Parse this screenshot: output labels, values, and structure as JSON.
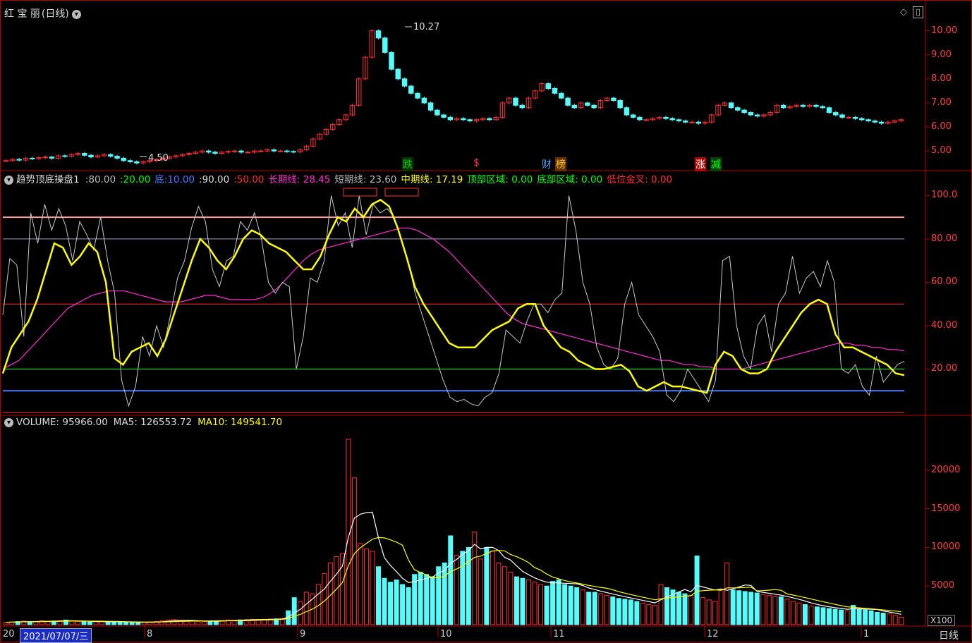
{
  "main_panel": {
    "stock_name": "红 宝 丽",
    "period": "(日线)",
    "high_label": "10.27",
    "low_label": "4.50",
    "yticks": [
      "10.00",
      "9.00",
      "8.00",
      "7.00",
      "6.00",
      "5.00"
    ],
    "signals": [
      {
        "text": "跌",
        "color": "#00cc00",
        "bg": "#003300"
      },
      {
        "text": "$",
        "color": "#ff3030",
        "bg": "#000"
      },
      {
        "text": "财",
        "color": "#4aa3ff",
        "bg": "#000"
      },
      {
        "text": "榜",
        "color": "#ffcc00",
        "bg": "#663300"
      },
      {
        "text": "涨",
        "color": "#ffffff",
        "bg": "#b00000"
      },
      {
        "text": "减",
        "color": "#00ff00",
        "bg": "#004400"
      }
    ]
  },
  "indicator_panel": {
    "name": "趋势顶底操盘1",
    "params": [
      {
        "label": ":80.00",
        "color": "#bbbbbb"
      },
      {
        "label": ":20.00",
        "color": "#00ff00"
      },
      {
        "label": "底:10.00",
        "color": "#4a7bff"
      },
      {
        "label": ":90.00",
        "color": "#dddddd"
      },
      {
        "label": ":50.00",
        "color": "#ff3030"
      },
      {
        "label": "长期线: 28.45",
        "color": "#ff30d0"
      },
      {
        "label": "短期线: 23.60",
        "color": "#bbbbbb"
      },
      {
        "label": "中期线: 17.19",
        "color": "#ffff00"
      },
      {
        "label": "顶部区域: 0.00",
        "color": "#00ff00"
      },
      {
        "label": "底部区域: 0.00",
        "color": "#00ff00"
      },
      {
        "label": "低位金叉: 0.00",
        "color": "#ff3030"
      }
    ],
    "yticks": [
      "100.0",
      "80.00",
      "60.00",
      "40.00",
      "20.00"
    ]
  },
  "volume_panel": {
    "label": "VOLUME: 95966.00",
    "ma5": "MA5: 126553.72",
    "ma10": "MA10: 149541.70",
    "yticks": [
      "20000",
      "15000",
      "10000",
      "5000"
    ],
    "unit": "X100"
  },
  "time_axis": {
    "current": "2021/07/07/三",
    "left_cut": "20",
    "months": [
      "8",
      "9",
      "10",
      "11",
      "12",
      "1"
    ],
    "period_button": "日线"
  },
  "chart_data": {
    "type": "candlestick",
    "title": "红宝丽(日线)",
    "price_ylim": [
      4.3,
      10.4
    ],
    "price_high": 10.27,
    "price_low": 4.5,
    "candles_closes": [
      4.6,
      4.65,
      4.62,
      4.7,
      4.68,
      4.72,
      4.75,
      4.7,
      4.8,
      4.78,
      4.85,
      4.9,
      4.82,
      4.75,
      4.8,
      4.85,
      4.78,
      4.7,
      4.6,
      4.55,
      4.5,
      4.55,
      4.6,
      4.65,
      4.7,
      4.75,
      4.8,
      4.85,
      4.9,
      4.95,
      5.0,
      4.95,
      4.9,
      4.95,
      4.98,
      5.0,
      4.95,
      4.95,
      5.0,
      5.0,
      5.05,
      5.0,
      5.0,
      4.98,
      4.96,
      5.05,
      5.2,
      5.5,
      5.7,
      5.9,
      6.1,
      6.3,
      6.5,
      6.9,
      8.0,
      8.9,
      10.0,
      9.7,
      9.1,
      8.4,
      8.0,
      7.7,
      7.4,
      7.2,
      7.0,
      6.7,
      6.5,
      6.4,
      6.3,
      6.35,
      6.3,
      6.25,
      6.3,
      6.35,
      6.3,
      6.4,
      7.0,
      7.2,
      6.9,
      6.8,
      7.2,
      7.5,
      7.8,
      7.6,
      7.4,
      7.2,
      6.9,
      6.8,
      7.0,
      6.9,
      6.8,
      7.1,
      7.2,
      7.1,
      6.8,
      6.5,
      6.4,
      6.3,
      6.3,
      6.35,
      6.4,
      6.35,
      6.3,
      6.25,
      6.2,
      6.2,
      6.15,
      6.2,
      6.5,
      6.9,
      7.0,
      6.8,
      6.7,
      6.6,
      6.5,
      6.45,
      6.5,
      6.6,
      6.9,
      6.8,
      6.85,
      6.9,
      6.85,
      6.9,
      6.85,
      6.8,
      6.6,
      6.5,
      6.4,
      6.4,
      6.35,
      6.3,
      6.25,
      6.2,
      6.15,
      6.2,
      6.25,
      6.3
    ],
    "indicator_ylim": [
      0,
      105
    ],
    "indicator_reference_lines": [
      90,
      80,
      50,
      20,
      10,
      0
    ],
    "long_term_line": [
      20,
      22,
      24,
      28,
      32,
      36,
      40,
      44,
      48,
      50,
      52,
      54,
      55,
      56,
      56,
      56,
      55,
      54,
      53,
      52,
      51,
      51,
      51,
      52,
      53,
      54,
      54,
      53,
      52,
      52,
      52,
      52,
      53,
      55,
      58,
      62,
      66,
      70,
      73,
      75,
      76,
      77,
      78,
      79,
      80,
      81,
      82,
      83,
      84,
      85,
      85,
      84,
      82,
      80,
      77,
      74,
      70,
      66,
      62,
      58,
      54,
      50,
      46,
      43,
      41,
      40,
      39,
      38,
      37,
      36,
      35,
      34,
      33,
      32,
      31,
      30,
      29,
      28,
      27,
      26,
      25,
      24,
      24,
      23,
      22,
      22,
      21,
      21,
      20,
      20,
      20,
      20,
      21,
      22,
      23,
      24,
      25,
      26,
      27,
      28,
      29,
      30,
      31,
      32,
      32,
      31,
      31,
      30,
      30,
      29,
      29,
      28.45
    ],
    "short_term_line": [
      45,
      71,
      68,
      35,
      92,
      78,
      96,
      84,
      94,
      86,
      70,
      88,
      82,
      75,
      90,
      70,
      55,
      15,
      3,
      12,
      35,
      26,
      40,
      30,
      45,
      62,
      70,
      85,
      95,
      88,
      66,
      58,
      70,
      72,
      88,
      84,
      92,
      80,
      60,
      55,
      60,
      58,
      20,
      35,
      62,
      60,
      70,
      100,
      86,
      92,
      76,
      100,
      82,
      96,
      92,
      94,
      90,
      80,
      70,
      55,
      45,
      35,
      25,
      15,
      7,
      5,
      6,
      4,
      3,
      7,
      9,
      18,
      38,
      35,
      32,
      42,
      50,
      50,
      46,
      52,
      55,
      100,
      84,
      60,
      50,
      30,
      22,
      20,
      25,
      50,
      60,
      45,
      40,
      35,
      28,
      8,
      5,
      10,
      20,
      15,
      10,
      5,
      15,
      70,
      72,
      40,
      26,
      20,
      40,
      45,
      28,
      50,
      55,
      72,
      55,
      62,
      65,
      58,
      70,
      60,
      20,
      18,
      22,
      12,
      8,
      26,
      14,
      18,
      22,
      23.6
    ],
    "mid_term_line": [
      18,
      30,
      36,
      42,
      52,
      65,
      78,
      76,
      68,
      72,
      78,
      74,
      60,
      25,
      22,
      28,
      30,
      32,
      26,
      34,
      46,
      58,
      70,
      80,
      76,
      70,
      66,
      72,
      80,
      84,
      82,
      78,
      76,
      74,
      70,
      66,
      66,
      72,
      82,
      90,
      88,
      94,
      90,
      96,
      98,
      95,
      85,
      72,
      58,
      50,
      44,
      38,
      32,
      30,
      30,
      30,
      34,
      38,
      40,
      42,
      48,
      50,
      50,
      40,
      35,
      30,
      28,
      24,
      22,
      20,
      20,
      21,
      22,
      19,
      12,
      10,
      12,
      14,
      12,
      12,
      11,
      10,
      9,
      22,
      28,
      26,
      20,
      18,
      18,
      20,
      28,
      34,
      40,
      46,
      50,
      52,
      50,
      36,
      30,
      30,
      28,
      26,
      24,
      22,
      18,
      17.19
    ],
    "volume_ylim": [
      0,
      25000
    ],
    "volume": [
      300,
      350,
      400,
      450,
      380,
      420,
      500,
      450,
      480,
      520,
      600,
      450,
      420,
      380,
      350,
      400,
      420,
      380,
      360,
      340,
      320,
      300,
      280,
      300,
      350,
      420,
      500,
      600,
      650,
      580,
      500,
      450,
      420,
      400,
      450,
      500,
      550,
      600,
      580,
      620,
      650,
      700,
      680,
      700,
      720,
      750,
      800,
      1800,
      3500,
      3000,
      4200,
      4000,
      5200,
      6600,
      8000,
      8800,
      9200,
      24000,
      19000,
      10500,
      9800,
      9500,
      7500,
      6000,
      5500,
      5800,
      5200,
      4800,
      6500,
      6800,
      6500,
      6200,
      7500,
      8000,
      11500,
      9000,
      9500,
      10000,
      12000,
      8500,
      10000,
      9500,
      8000,
      7500,
      6800,
      6200,
      6000,
      5800,
      5500,
      5200,
      5000,
      5600,
      5800,
      5200,
      5000,
      4800,
      4500,
      4200,
      4200,
      4000,
      3800,
      3600,
      3400,
      3300,
      3200,
      3000,
      2800,
      2600,
      2500,
      5200,
      4800,
      4500,
      4200,
      4000,
      3800,
      8900,
      3500,
      3200,
      3000,
      4500,
      8000,
      4500,
      4400,
      4300,
      4200,
      4100,
      3900,
      3800,
      3700,
      3600,
      3300,
      3000,
      2800,
      2600,
      2400,
      2300,
      2200,
      2100,
      2000,
      1900,
      1800,
      2500,
      2000,
      1900,
      1800,
      1600,
      1500,
      1400,
      1200,
      960
    ],
    "volume_ma5_label": 126553.72,
    "volume_ma10_label": 149541.7,
    "x_month_labels": [
      "8",
      "9",
      "10",
      "11",
      "12",
      "1"
    ]
  }
}
